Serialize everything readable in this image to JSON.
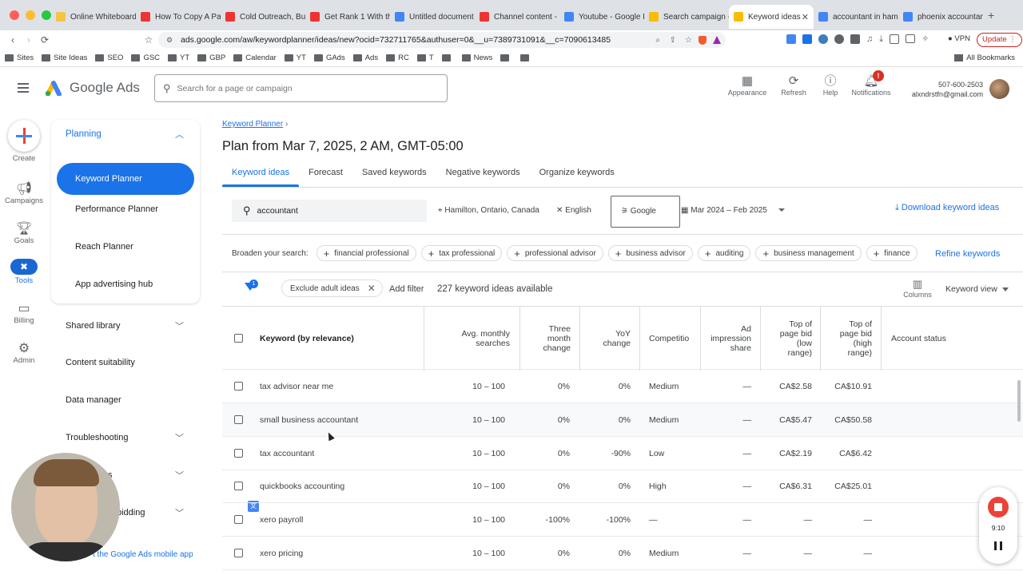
{
  "browser": {
    "tabs": [
      {
        "title": "Online Whiteboard",
        "color": "#f4c542"
      },
      {
        "title": "How To Copy A Pa",
        "color": "#e33"
      },
      {
        "title": "Cold Outreach, But",
        "color": "#e33"
      },
      {
        "title": "Get Rank 1 With th",
        "color": "#e33"
      },
      {
        "title": "Untitled document",
        "color": "#4285f4"
      },
      {
        "title": "Channel content -",
        "color": "#e33"
      },
      {
        "title": "Youtube - Google D",
        "color": "#4285f4"
      },
      {
        "title": "Search campaign -",
        "color": "#fbbc04"
      },
      {
        "title": "Keyword ideas",
        "color": "#fbbc04"
      },
      {
        "title": "accountant in ham",
        "color": "#4285f4"
      },
      {
        "title": "phoenix accountan",
        "color": "#4285f4"
      }
    ],
    "url": "ads.google.com/aw/keywordplanner/ideas/new?ocid=732711765&authuser=0&__u=7389731091&__c=7090613485",
    "vpn": "VPN",
    "update": "Update",
    "bookmarks": [
      "Sites",
      "Site Ideas",
      "SEO",
      "GSC",
      "YT",
      "GBP",
      "Calendar",
      "YT",
      "GAds",
      "Ads",
      "RC",
      "T",
      "",
      "News",
      "",
      ""
    ],
    "all_bookmarks": "All Bookmarks"
  },
  "header": {
    "brand": "Google Ads",
    "search_placeholder": "Search for a page or campaign",
    "appearance": "Appearance",
    "refresh": "Refresh",
    "help": "Help",
    "notifications": "Notifications",
    "notif_badge": "!",
    "phone": "507-600-2503",
    "email": "alxndrstfn@gmail.com"
  },
  "rail": {
    "create": "Create",
    "campaigns": "Campaigns",
    "goals": "Goals",
    "tools": "Tools",
    "billing": "Billing",
    "admin": "Admin"
  },
  "side": {
    "planning": "Planning",
    "keyword_planner": "Keyword Planner",
    "performance_planner": "Performance Planner",
    "reach_planner": "Reach Planner",
    "app_hub": "App advertising hub",
    "shared_library": "Shared library",
    "content_suitability": "Content suitability",
    "data_manager": "Data manager",
    "troubleshooting": "Troubleshooting",
    "partial1": "s",
    "partial2": "bidding",
    "mobile_app": "t the Google Ads mobile app"
  },
  "main": {
    "breadcrumb": "Keyword Planner",
    "breadcrumb_sep": "›",
    "title": "Plan from Mar 7, 2025, 2 AM, GMT-05:00",
    "tabs": [
      "Keyword ideas",
      "Forecast",
      "Saved keywords",
      "Negative keywords",
      "Organize keywords"
    ],
    "search_value": "accountant",
    "location": "Hamilton, Ontario, Canada",
    "language": "English",
    "network": "Google",
    "date_range": "Mar 2024 – Feb 2025",
    "download": "Download keyword ideas",
    "broaden_label": "Broaden your search:",
    "broaden_chips": [
      "financial professional",
      "tax professional",
      "professional advisor",
      "business advisor",
      "auditing",
      "business management",
      "finance"
    ],
    "refine": "Refine keywords",
    "filter_badge": "1",
    "exclude_chip": "Exclude adult ideas",
    "add_filter": "Add filter",
    "ideas_count": "227 keyword ideas available",
    "columns": "Columns",
    "keyword_view": "Keyword view"
  },
  "table": {
    "headers": {
      "keyword": "Keyword (by relevance)",
      "avg": [
        "Avg. monthly",
        "searches"
      ],
      "three": [
        "Three",
        "month",
        "change"
      ],
      "yoy": [
        "YoY",
        "change"
      ],
      "comp": [
        "Competitio"
      ],
      "ad": [
        "Ad",
        "impression",
        "share"
      ],
      "low": [
        "Top of",
        "page bid",
        "(low",
        "range)"
      ],
      "high": [
        "Top of",
        "page bid",
        "(high",
        "range)"
      ],
      "status": "Account status"
    },
    "rows": [
      {
        "kw": "tax advisor near me",
        "avg": "10 – 100",
        "three": "0%",
        "yoy": "0%",
        "comp": "Medium",
        "ad": "—",
        "low": "CA$2.58",
        "high": "CA$10.91"
      },
      {
        "kw": "small business accountant",
        "avg": "10 – 100",
        "three": "0%",
        "yoy": "0%",
        "comp": "Medium",
        "ad": "—",
        "low": "CA$5.47",
        "high": "CA$50.58"
      },
      {
        "kw": "tax accountant",
        "avg": "10 – 100",
        "three": "0%",
        "yoy": "-90%",
        "comp": "Low",
        "ad": "—",
        "low": "CA$2.19",
        "high": "CA$6.42"
      },
      {
        "kw": "quickbooks accounting",
        "avg": "10 – 100",
        "three": "0%",
        "yoy": "0%",
        "comp": "High",
        "ad": "—",
        "low": "CA$6.31",
        "high": "CA$25.01"
      },
      {
        "kw": "xero payroll",
        "avg": "10 – 100",
        "three": "-100%",
        "yoy": "-100%",
        "comp": "—",
        "ad": "—",
        "low": "—",
        "high": "—"
      },
      {
        "kw": "xero pricing",
        "avg": "10 – 100",
        "three": "0%",
        "yoy": "0%",
        "comp": "Medium",
        "ad": "—",
        "low": "—",
        "high": "—"
      }
    ]
  },
  "recorder": {
    "time": "9:10"
  }
}
